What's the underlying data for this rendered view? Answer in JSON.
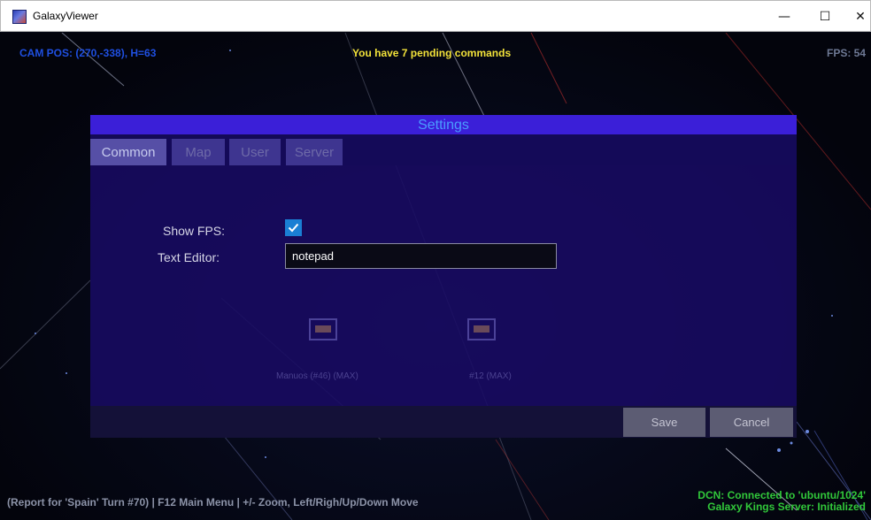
{
  "window": {
    "title": "GalaxyViewer",
    "controls": {
      "minimize": "—",
      "maximize": "☐",
      "close": "✕"
    }
  },
  "hud": {
    "cam_pos": "CAM POS: (270,-338), H=63",
    "pending": "You have 7 pending commands",
    "fps": "FPS: 54",
    "report": "(Report for 'Spain' Turn #70) | F12 Main Menu | +/- Zoom, Left/Righ/Up/Down Move",
    "dcn_line1": "DCN: Connected to 'ubuntu/1024'",
    "dcn_line2": "Galaxy Kings Server: Initialized"
  },
  "settings": {
    "title": "Settings",
    "tabs": [
      {
        "label": "Common",
        "active": true
      },
      {
        "label": "Map",
        "active": false
      },
      {
        "label": "User",
        "active": false
      },
      {
        "label": "Server",
        "active": false
      }
    ],
    "show_fps_label": "Show FPS:",
    "show_fps_checked": true,
    "text_editor_label": "Text Editor:",
    "text_editor_value": "notepad",
    "save_label": "Save",
    "cancel_label": "Cancel"
  },
  "background_planets": [
    {
      "label": "Manuos (#46) (MAX)"
    },
    {
      "label": "#12 (MAX)"
    }
  ],
  "colors": {
    "hud_cam": "#1f4fe0",
    "hud_pending": "#f2e23a",
    "hud_dcn": "#31c83a",
    "dialog_header": "#3b1fd8",
    "checkbox": "#1a7fd4"
  },
  "icons": [
    "app-icon",
    "minimize-icon",
    "maximize-icon",
    "close-icon",
    "checkmark-icon"
  ]
}
